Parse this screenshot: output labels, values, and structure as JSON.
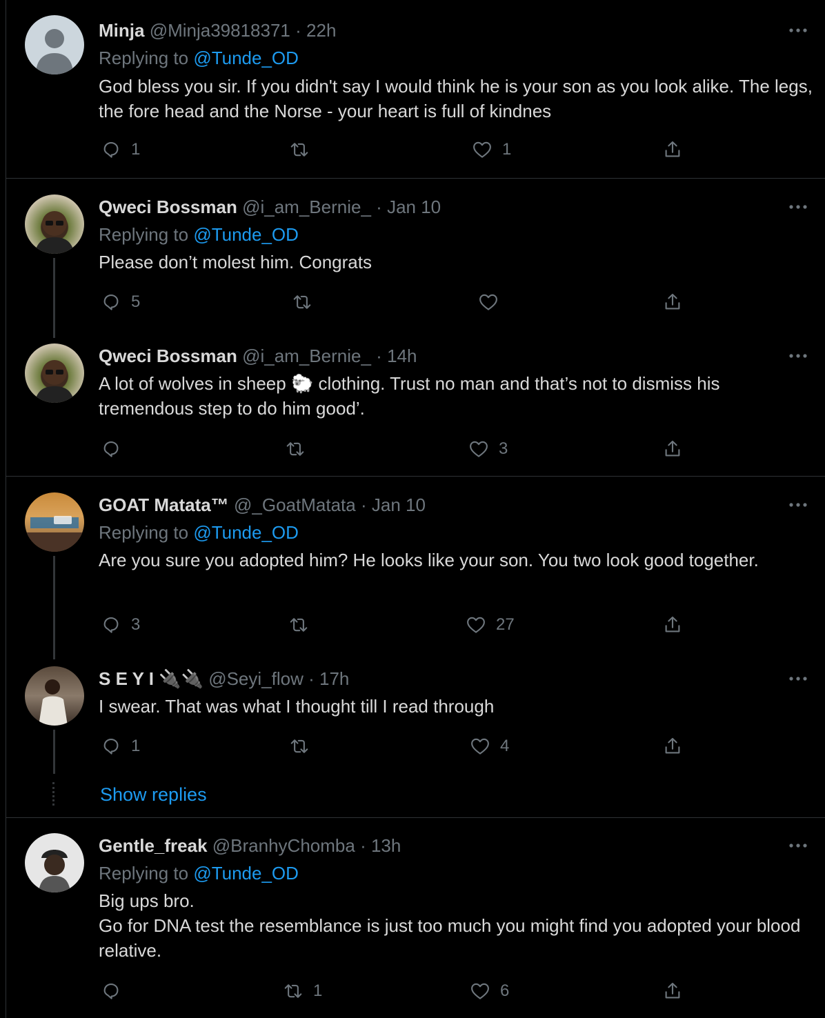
{
  "tweets": [
    {
      "name": "Minja",
      "handle": "@Minja39818371",
      "time": "22h",
      "replying_label": "Replying to",
      "replying_to": "@Tunde_OD",
      "text": "God bless you sir. If you didn't say I would think he is your son as you look alike. The legs, the fore head and the Norse - your heart is full of kindnes",
      "replies": "1",
      "retweets": "",
      "likes": "1"
    },
    {
      "name": "Qweci Bossman",
      "handle": "@i_am_Bernie_",
      "time": "Jan 10",
      "replying_label": "Replying to",
      "replying_to": "@Tunde_OD",
      "text": "Please don’t molest him. Congrats",
      "replies": "5",
      "retweets": "",
      "likes": ""
    },
    {
      "name": "Qweci Bossman",
      "handle": "@i_am_Bernie_",
      "time": "14h",
      "text": "A lot of wolves in sheep 🐑 clothing. Trust no man and that’s not to dismiss his tremendous step to do him good’.",
      "replies": "",
      "retweets": "",
      "likes": "3"
    },
    {
      "name": "GOAT Matata™",
      "handle": "@_GoatMatata",
      "time": "Jan 10",
      "replying_label": "Replying to",
      "replying_to": "@Tunde_OD",
      "text": "Are you sure you adopted him? He looks like your son. You two look good together.",
      "replies": "3",
      "retweets": "",
      "likes": "27"
    },
    {
      "name": "S E Y I 🔌🔌",
      "handle": "@Seyi_flow",
      "time": "17h",
      "text": "I swear. That was what I thought till I read through",
      "replies": "1",
      "retweets": "",
      "likes": "4"
    },
    {
      "name": "Gentle_freak",
      "handle": "@BranhyChomba",
      "time": "13h",
      "replying_label": "Replying to",
      "replying_to": "@Tunde_OD",
      "text": "Big ups bro.\nGo for DNA test the resemblance is just too much you might find you adopted your blood relative.",
      "replies": "",
      "retweets": "1",
      "likes": "6"
    }
  ],
  "show_replies_label": "Show replies",
  "separator": "·",
  "icons": {
    "reply": "reply-icon",
    "retweet": "retweet-icon",
    "like": "heart-icon",
    "share": "share-icon",
    "more": "more-icon"
  },
  "colors": {
    "background": "#000000",
    "text": "#d9d9d9",
    "muted": "#6e767d",
    "accent": "#1d9bf0",
    "border": "#2f3336"
  }
}
